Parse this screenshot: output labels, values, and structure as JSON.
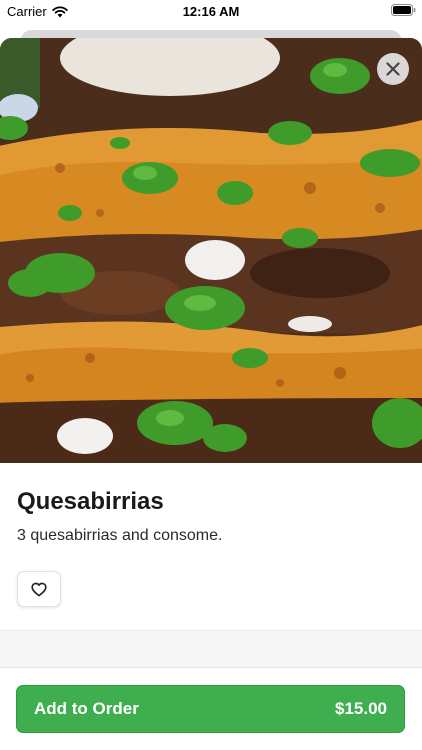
{
  "status_bar": {
    "carrier": "Carrier",
    "time": "12:16 AM"
  },
  "item": {
    "name": "Quesabirrias",
    "description": "3 quesabirrias and consome."
  },
  "order_button": {
    "label": "Add to Order",
    "price": "$15.00"
  },
  "icons": {
    "close": "close-icon",
    "favorite": "heart-icon",
    "wifi": "wifi-icon",
    "battery": "battery-icon"
  },
  "colors": {
    "accent_green": "#3fae4f",
    "close_bg": "#e6e6e6"
  }
}
